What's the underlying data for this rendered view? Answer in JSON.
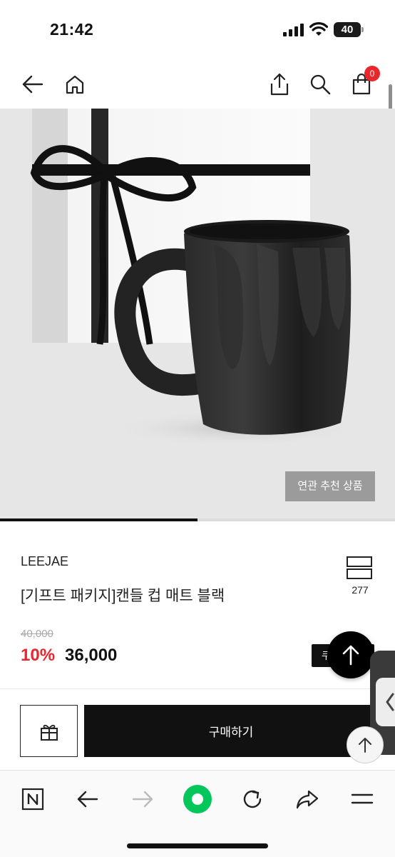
{
  "status_bar": {
    "time": "21:42",
    "battery_level": "40",
    "icons": [
      "signal-icon",
      "wifi-icon",
      "battery-icon"
    ]
  },
  "top_nav": {
    "icons": [
      "back-arrow-icon",
      "home-icon",
      "share-icon",
      "search-icon",
      "shopping-bag-icon"
    ],
    "cart_count": "0",
    "badge_color": "#e8262b"
  },
  "product": {
    "image_text": "LEEJAE",
    "related_button_label": "연관 추천 상품",
    "carousel_progress": 0.5,
    "brand": "LEEJAE",
    "name": "[기프트 패키지]캔들 컵 매트 블랙",
    "wishlist_count": "277",
    "original_price": "40,000",
    "discount_rate": "10%",
    "sale_price": "36,000",
    "coupon_label": "쿠폰",
    "accent_color": "#e8262b"
  },
  "actions": {
    "buy_label": "구매하기",
    "icons": [
      "gift-icon",
      "arrow-up-icon",
      "chevron-left-icon"
    ]
  },
  "browser_toolbar": {
    "icons": [
      "naver-n-icon",
      "back-icon",
      "forward-icon",
      "green-dot-icon",
      "reload-icon",
      "share-icon",
      "menu-icon"
    ],
    "brand_color": "#03c75a"
  }
}
